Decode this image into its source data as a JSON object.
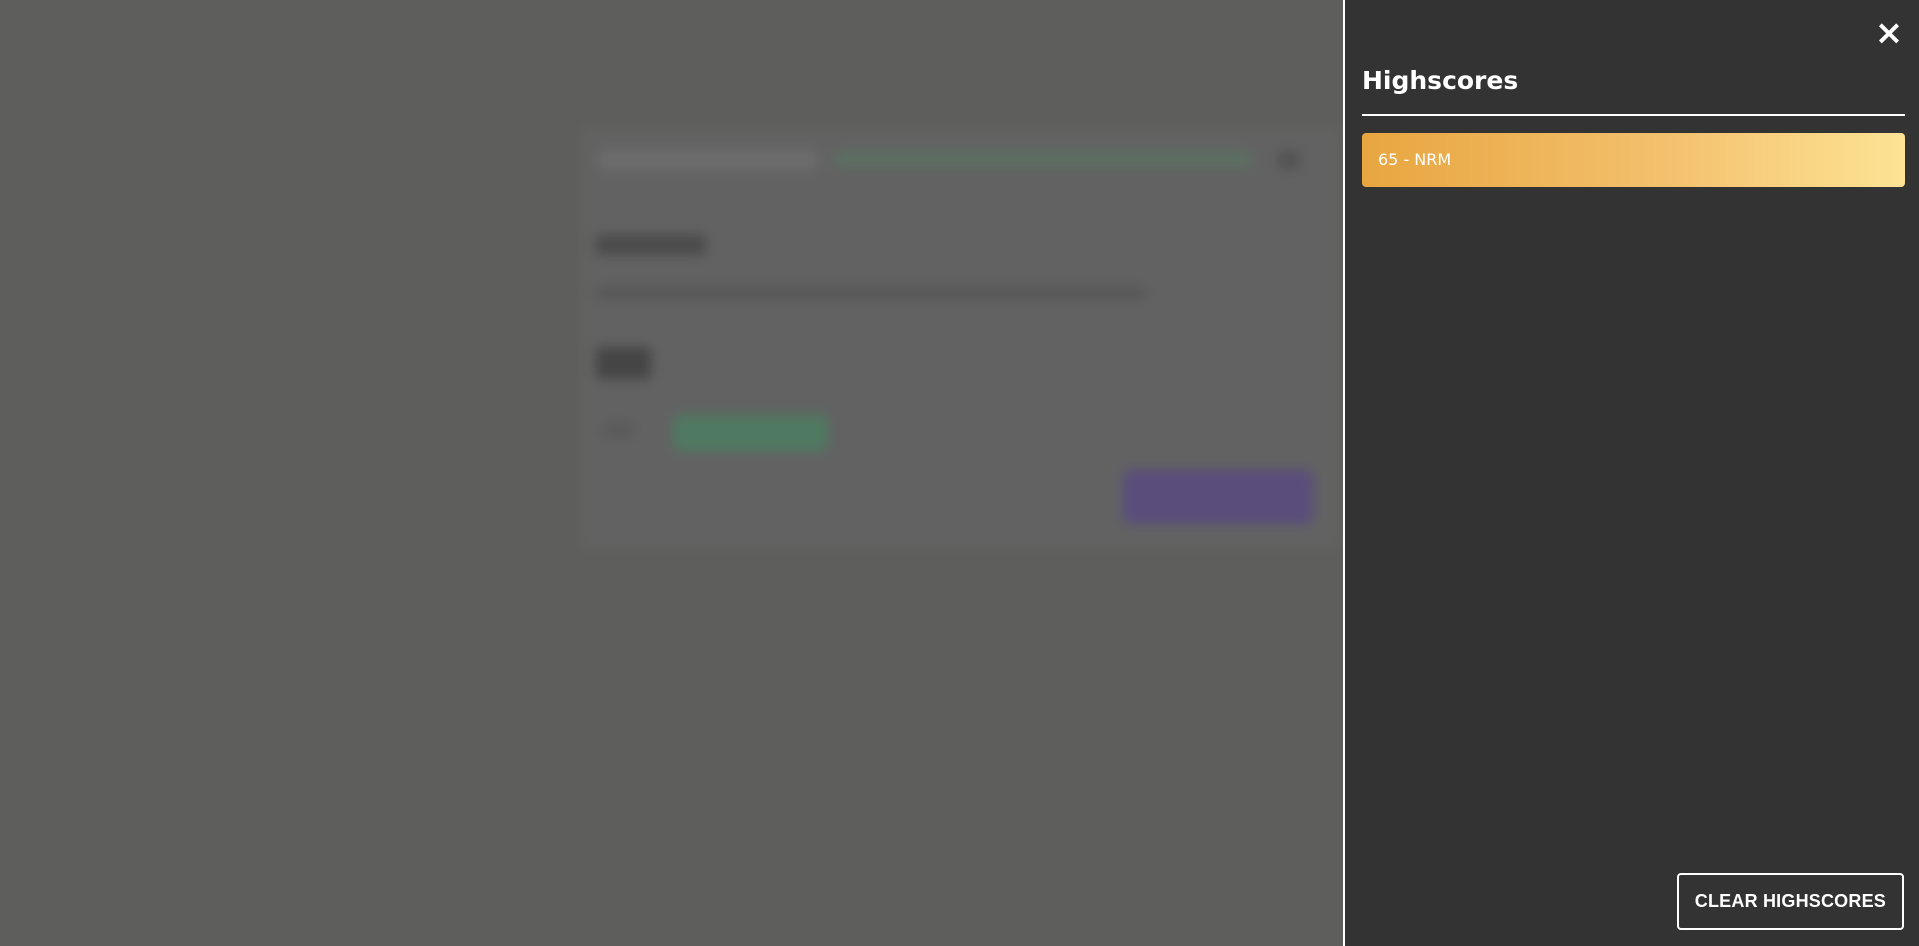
{
  "panel": {
    "title": "Highscores",
    "close_icon": "×",
    "scores": [
      {
        "label": "65 - NRM"
      }
    ],
    "clear_button_label": "CLEAR HIGHSCORES"
  },
  "colors": {
    "panel_bg": "#333333",
    "overlay_bg": "#5e5e5c",
    "score_gradient_start": "#e8a640",
    "score_gradient_end": "#fde395"
  }
}
